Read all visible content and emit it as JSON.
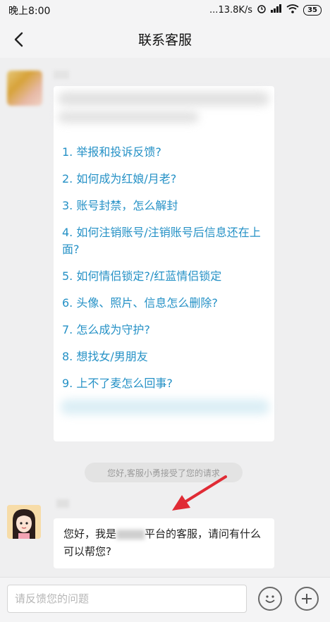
{
  "status_bar": {
    "time": "晚上8:00",
    "network_speed": "...13.8K/s",
    "battery": "35"
  },
  "header": {
    "title": "联系客服"
  },
  "menu": {
    "items": [
      "1. 举报和投诉反馈?",
      "2. 如何成为红娘/月老?",
      "3. 账号封禁，怎么解封",
      "4. 如何注销账号/注销账号后信息还在上面?",
      "5. 如何情侣锁定?/红蓝情侣锁定",
      "6. 头像、照片、信息怎么删除?",
      "7. 怎么成为守护?",
      "8. 想找女/男朋友",
      "9. 上不了麦怎么回事?"
    ]
  },
  "system_notice": "您好,客服小勇接受了您的请求",
  "agent_message": {
    "prefix": "您好，我是",
    "suffix": "平台的客服，请问有什么可以帮您?"
  },
  "input": {
    "placeholder": "请反馈您的问题"
  },
  "colors": {
    "link": "#2591c6",
    "arrow": "#e02b35"
  }
}
